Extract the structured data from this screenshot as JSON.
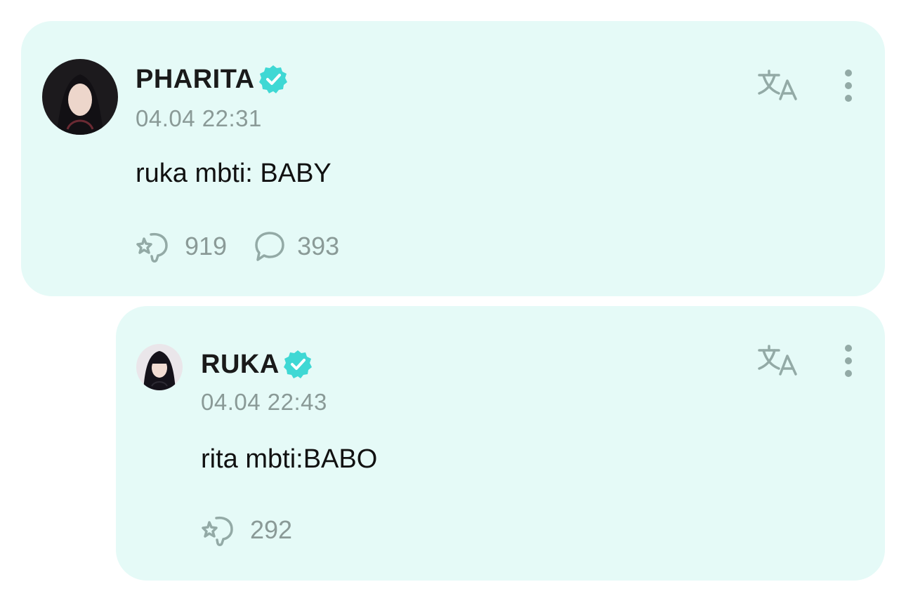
{
  "colors": {
    "card_background": "#e5faf7",
    "verified_badge": "#3fd8d4",
    "muted_text": "#8a9a97",
    "icon": "#93aaa6"
  },
  "post": {
    "author": "PHARITA",
    "verified": true,
    "timestamp": "04.04 22:31",
    "text": "ruka mbti: BABY",
    "reactions": "919",
    "comments": "393",
    "icons": [
      "avatar",
      "verified-badge-icon",
      "translate-icon",
      "more-vertical-icon",
      "reaction-icon",
      "comment-icon"
    ]
  },
  "reply": {
    "author": "RUKA",
    "verified": true,
    "timestamp": "04.04 22:43",
    "text": "rita mbti:BABO",
    "reactions": "292",
    "icons": [
      "avatar",
      "verified-badge-icon",
      "translate-icon",
      "more-vertical-icon",
      "reaction-icon"
    ]
  }
}
